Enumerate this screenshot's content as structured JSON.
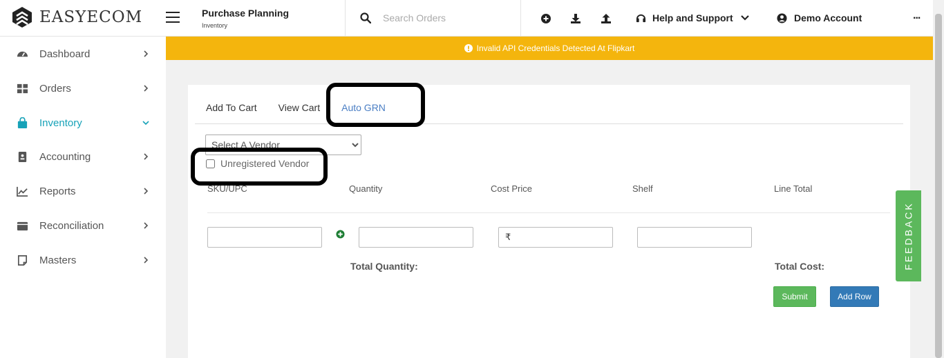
{
  "brand": {
    "name": "EASYECOM"
  },
  "header": {
    "title": "Purchase Planning",
    "subtitle": "Inventory",
    "search_placeholder": "Search Orders",
    "help_label": "Help and Support",
    "account_label": "Demo Account",
    "more_label": "..."
  },
  "sidebar": {
    "items": [
      {
        "label": "Dashboard",
        "icon": "dashboard-gauge-icon",
        "active": false
      },
      {
        "label": "Orders",
        "icon": "grid-icon",
        "active": false
      },
      {
        "label": "Inventory",
        "icon": "shopping-bag-icon",
        "active": true
      },
      {
        "label": "Accounting",
        "icon": "ledger-icon",
        "active": false
      },
      {
        "label": "Reports",
        "icon": "line-chart-icon",
        "active": false
      },
      {
        "label": "Reconciliation",
        "icon": "wallet-icon",
        "active": false
      },
      {
        "label": "Masters",
        "icon": "note-icon",
        "active": false
      }
    ]
  },
  "alert": {
    "message": "Invalid API Credentials Detected At Flipkart",
    "color": "#f4b50d"
  },
  "tabs": [
    {
      "label": "Add To Cart"
    },
    {
      "label": "View Cart"
    },
    {
      "label": "Auto GRN"
    }
  ],
  "vendor_select": {
    "placeholder": "Select A Vendor"
  },
  "unregistered_vendor": {
    "label": "Unregistered Vendor",
    "checked": false
  },
  "columns": [
    "SKU/UPC",
    "Quantity",
    "Cost Price",
    "Shelf",
    "Line Total"
  ],
  "row": {
    "currency_symbol": "₹"
  },
  "totals": {
    "quantity_label": "Total Quantity:",
    "cost_label": "Total Cost:"
  },
  "buttons": {
    "submit": "Submit",
    "add_row": "Add Row"
  },
  "feedback": {
    "label": "FEEDBACK"
  },
  "colors": {
    "accent": "#17a2b8",
    "tab_active": "#4a7ec4",
    "success": "#5cb85c",
    "primary": "#337ab7"
  }
}
